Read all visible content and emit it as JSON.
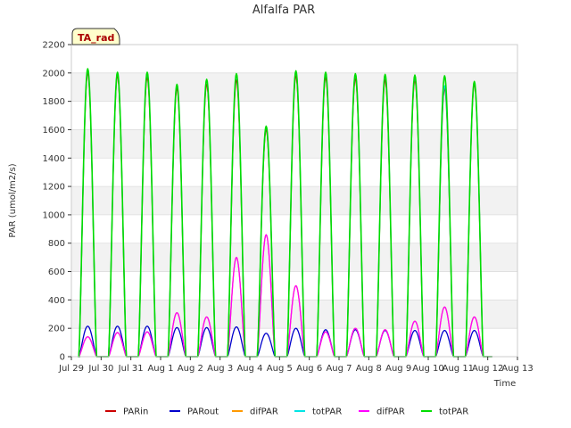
{
  "chart_data": {
    "type": "line",
    "title": "Alfalfa PAR",
    "xlabel": "Time",
    "ylabel": "PAR (umol/m2/s)",
    "ylim": [
      0,
      2200
    ],
    "yticks": [
      0,
      200,
      400,
      600,
      800,
      1000,
      1200,
      1400,
      1600,
      1800,
      2000,
      2200
    ],
    "xlim": [
      0,
      15
    ],
    "xtick_labels": [
      "Jul 29",
      "Jul 30",
      "Jul 31",
      "Aug 1",
      "Aug 2",
      "Aug 3",
      "Aug 4",
      "Aug 5",
      "Aug 6",
      "Aug 7",
      "Aug 8",
      "Aug 9",
      "Aug 10",
      "Aug 11",
      "Aug 12",
      "Aug 13"
    ],
    "grid": "horizontal bands",
    "tag_label": "TA_rad",
    "legend_position": "bottom",
    "day_centers": [
      0.55,
      1.55,
      2.55,
      3.55,
      4.55,
      5.55,
      6.55,
      7.55,
      8.55,
      9.55,
      10.55,
      11.55,
      12.55,
      13.55
    ],
    "series": [
      {
        "name": "PARin",
        "color": "#cc0000",
        "peaks": [
          2000,
          1980,
          1970,
          1890,
          1920,
          1950,
          1600,
          1980,
          1970,
          1960,
          1950,
          1950,
          1890,
          1920
        ]
      },
      {
        "name": "PARout",
        "color": "#0000cc",
        "peaks": [
          215,
          215,
          215,
          205,
          205,
          210,
          165,
          200,
          190,
          190,
          185,
          185,
          185,
          185
        ]
      },
      {
        "name": "difPAR",
        "color": "#ff9900",
        "peaks": [
          140,
          170,
          175,
          310,
          280,
          700,
          860,
          500,
          175,
          200,
          190,
          250,
          350,
          280
        ]
      },
      {
        "name": "totPAR",
        "color": "#00e5e5",
        "peaks": [
          2020,
          2000,
          2000,
          1915,
          1950,
          1990,
          1620,
          2010,
          2000,
          1990,
          1985,
          1975,
          1910,
          1935
        ]
      },
      {
        "name": "difPAR",
        "color": "#ff00ff",
        "peaks": [
          140,
          170,
          175,
          310,
          280,
          700,
          860,
          500,
          175,
          200,
          190,
          250,
          350,
          280
        ]
      },
      {
        "name": "totPAR",
        "color": "#00dd00",
        "peaks": [
          2030,
          2005,
          2005,
          1920,
          1955,
          1995,
          1625,
          2015,
          2005,
          1995,
          1990,
          1985,
          1980,
          1940
        ]
      }
    ]
  }
}
